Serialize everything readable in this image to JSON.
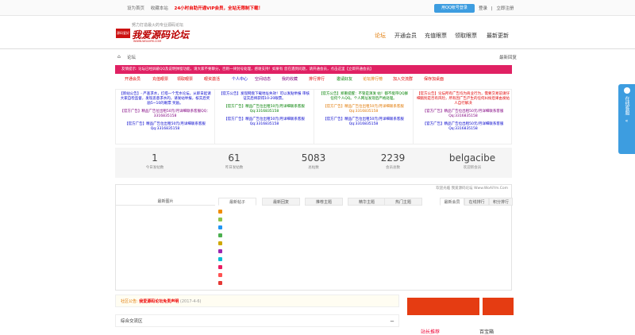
{
  "topbar": {
    "set_home": "设为首页",
    "bookmark": "收藏本站",
    "promo": "24小时自助开通VIP会员，全站无限制下载！",
    "qq_login": "用QQ帐号登录",
    "login": "登录",
    "sep": "|",
    "register": "立即注册"
  },
  "logo": {
    "badge": "源码爱好",
    "slogan": "努力打造最火的专业源码论坛",
    "name": "我爱源码论坛",
    "url": "WWW.WOAIYM.COM"
  },
  "nav": {
    "items": [
      "论坛",
      "开通会员",
      "充值眼票",
      "领取眼票",
      "最新更新"
    ],
    "active_index": 0
  },
  "breadcrumb": {
    "home_icon": "home-icon",
    "current": "论坛",
    "right": "最新回复"
  },
  "notice": {
    "text": "友情提示: 论坛已经屏蔽QQ及说明弹窗功能，请大家不要聊分，否则一律封号处理，感谢支持！如果有 您在遇到问题，请开通会员，点击这里【立即开通会员】"
  },
  "quick_links": [
    {
      "label": "开通会员",
      "color": "#e00000"
    },
    {
      "label": "充值眼票",
      "color": "#e00000"
    },
    {
      "label": "领取眼票",
      "color": "#e00000"
    },
    {
      "label": "眼资激活",
      "color": "#e00000"
    },
    {
      "label": "个人中心",
      "color": "#0000cc"
    },
    {
      "label": "空间动态",
      "color": "#800080"
    },
    {
      "label": "我的收藏",
      "color": "#800080"
    },
    {
      "label": "排行排行",
      "color": "#e00000"
    },
    {
      "label": "邀请好友",
      "color": "#008000"
    },
    {
      "label": "论坛排行榜",
      "color": "#e07700"
    },
    {
      "label": "加入交流群",
      "color": "#e00000"
    },
    {
      "label": "保存加桌面",
      "color": "#e00000"
    }
  ],
  "ads": [
    {
      "main": "【新站公告】- 严查求水，灯塔一个无水论坛，从即日起请大家自检监督，发现恶意求水的，请发站举报，核实后奖励5~10的眼票 奖励。",
      "main_color": "#0000cc",
      "a1": "【官方广告】精品广告位出租50元/月详细联系客服QQ：3316835158",
      "a2": "【官方广告】精品广告位出租50元/月详细联系客服Qq:3316835158"
    },
    {
      "main": "【官方公告】发现网盘下载地址失效！可以发贴举报 审核证实后将获得10-20眼票。",
      "main_color": "#0000cc",
      "a1": "【官方广告】精品广告位出租50元/月详细联系客服Qq:3316835158",
      "a2": "【官方广告】精品广告位出租50元/月详细联系客服Qq:3316835158"
    },
    {
      "main": "【官方公告】郑重提醒：不管是演发 帖！都不能带QQ群 任何个人QQ。个人网址发现后严格处理。",
      "main_color": "#008000",
      "a1": "【官方广告】精品广告位出租50元/月详细联系客服Qq:3316835158",
      "a2": "【官方广告】精品广告位出租50元/月详细联系客服Qq:3316835158"
    },
    {
      "main": "【官方公告】论坛所有广告均为商业行为，需要交易前请仔细甄别是否有风险，所有因广告产生的任何纠纷后果由发帖人自行解决",
      "main_color": "#e00000",
      "a1": "【官方广告】精品广告位出租50元/月详细联系客服Qq:3316835158",
      "a2": "【官方广告】精品广告位出租50元/月详细联系客服Qq:3316835158"
    }
  ],
  "stats": [
    {
      "value": "1",
      "label": "今日发帖数"
    },
    {
      "value": "61",
      "label": "昨日发帖数"
    },
    {
      "value": "5083",
      "label": "总帖数"
    },
    {
      "value": "2239",
      "label": "会员总数"
    },
    {
      "value": "belgacibe",
      "label": "欢迎新会员"
    }
  ],
  "panel": {
    "note": "欢迎光临 我爱源码论坛 Www.WoAiYm.Com",
    "pic_label": "最新图片",
    "tabs": [
      "最新帖子",
      "最新回复",
      "推荐主题",
      "精华主题",
      "热门主题"
    ],
    "side_tabs": [
      "最新会员",
      "在线排行",
      "积分排行"
    ],
    "rank_colors": [
      "#f08c00",
      "#8bc34a",
      "#2196f3",
      "#4caf50",
      "#cfa800",
      "#9c27b0",
      "#00bcd4",
      "#e91e63",
      "#ff5252",
      "#e53935"
    ]
  },
  "bottom_notice": {
    "prefix": "社区公告:",
    "title": "我爱源码论坛免责声明",
    "date": "(2017-4-6)"
  },
  "section": {
    "title": "综合交流区",
    "toggle": "−"
  },
  "sidebar": {
    "recommend": "站长推荐",
    "treasure": "百宝箱"
  },
  "float_qq": {
    "text": "在线客服"
  }
}
